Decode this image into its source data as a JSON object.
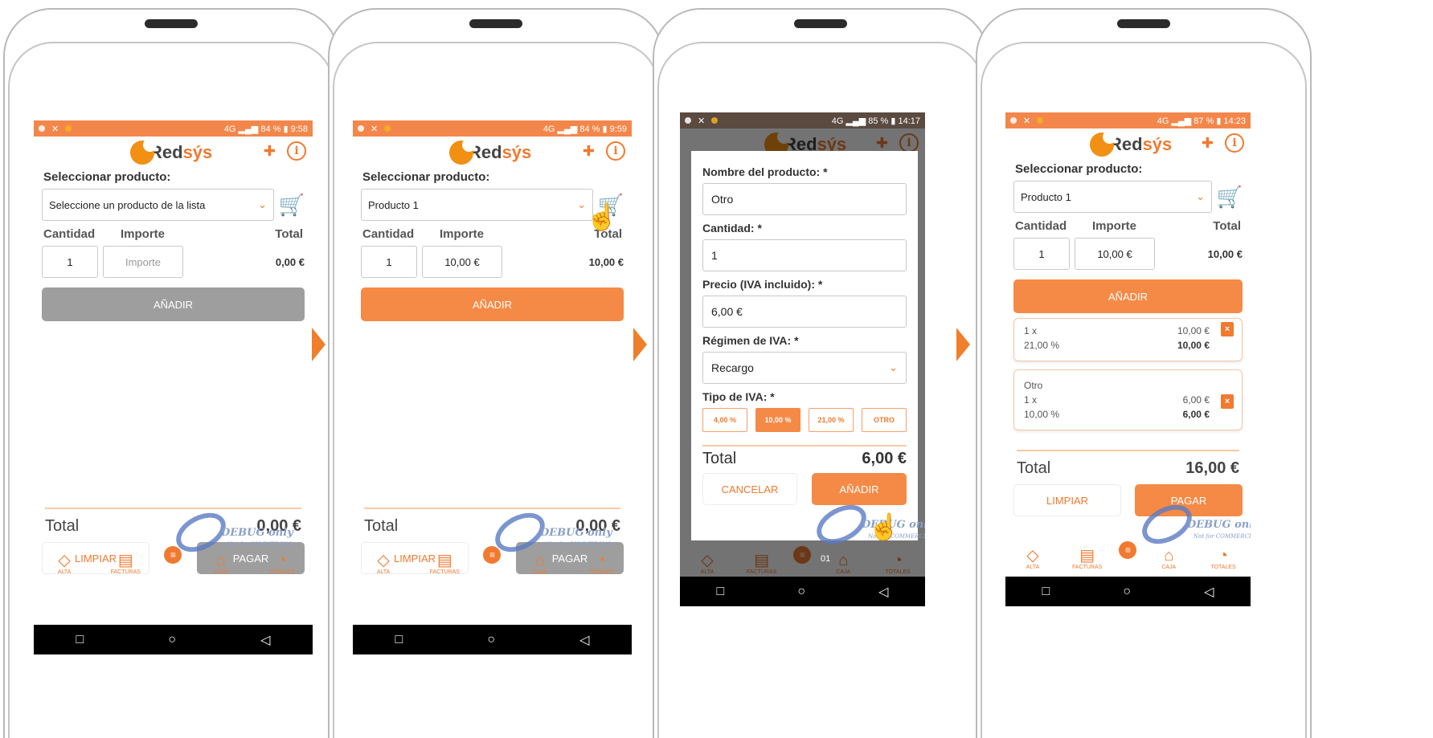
{
  "brand": {
    "part1": "Red",
    "part2": "sýs"
  },
  "arrows": 3,
  "screens": [
    {
      "status": {
        "network": "4G",
        "battery": "84 %",
        "time": "9:58"
      },
      "select_label": "Seleccionar producto:",
      "select_value": "Seleccione un producto de la lista",
      "col_qty": "Cantidad",
      "col_imp": "Importe",
      "col_tot": "Total",
      "qty": "1",
      "imp": "Importe",
      "tot": "0,00 €",
      "add": "AÑADIR",
      "total_label": "Total",
      "total_value": "0,00 €",
      "clear": "LIMPIAR",
      "pay": "PAGAR"
    },
    {
      "status": {
        "network": "4G",
        "battery": "84 %",
        "time": "9:59"
      },
      "select_label": "Seleccionar producto:",
      "select_value": "Producto 1",
      "col_qty": "Cantidad",
      "col_imp": "Importe",
      "col_tot": "Total",
      "qty": "1",
      "imp": "10,00 €",
      "tot": "10,00 €",
      "add": "AÑADIR",
      "total_label": "Total",
      "total_value": "0,00 €",
      "clear": "LIMPIAR",
      "pay": "PAGAR"
    },
    {
      "status": {
        "network": "4G",
        "battery": "85 %",
        "time": "14:17"
      },
      "modal": {
        "name_label": "Nombre del producto: *",
        "name_value": "Otro",
        "qty_label": "Cantidad: *",
        "qty_value": "1",
        "price_label": "Precio (IVA incluido): *",
        "price_value": "6,00 €",
        "regime_label": "Régimen de IVA: *",
        "regime_value": "Recargo",
        "type_label": "Tipo de IVA: *",
        "types": [
          "4,00 %",
          "10,00 %",
          "21,00 %",
          "OTRO"
        ],
        "total_label": "Total",
        "total_value": "6,00 €",
        "cancel": "CANCELAR",
        "add": "AÑADIR"
      },
      "badge": "01"
    },
    {
      "status": {
        "network": "4G",
        "battery": "87 %",
        "time": "14:23"
      },
      "select_label": "Seleccionar producto:",
      "select_value": "Producto 1",
      "col_qty": "Cantidad",
      "col_imp": "Importe",
      "col_tot": "Total",
      "qty": "1",
      "imp": "10,00 €",
      "tot": "10,00 €",
      "add": "AÑADIR",
      "items": [
        {
          "name": "",
          "qty": "1 x",
          "price": "10,00 €",
          "vat": "21,00 %",
          "line_total": "10,00 €"
        },
        {
          "name": "Otro",
          "qty": "1 x",
          "price": "6,00 €",
          "vat": "10,00 %",
          "line_total": "6,00 €"
        }
      ],
      "total_label": "Total",
      "total_value": "16,00 €",
      "clear": "LIMPIAR",
      "pay": "PAGAR"
    }
  ],
  "nav": {
    "alta": "ALTA",
    "facturas": "FACTURAS",
    "caja": "CAJA",
    "totales": "TOTALES"
  },
  "watermark": {
    "line1": "DEBUG only",
    "line2": "Not for COMMERCIAL"
  },
  "sysnav": {
    "recent": "□",
    "home": "○",
    "back": "◁"
  },
  "icons": {
    "add_user": "add-user-icon",
    "info": "info-icon",
    "cart": "cart-icon",
    "trash": "trash-icon",
    "hand": "pointing-hand-icon"
  },
  "colors": {
    "accent": "#f58a46",
    "status_bar": "#f3874b",
    "disabled": "#9e9e9e"
  }
}
